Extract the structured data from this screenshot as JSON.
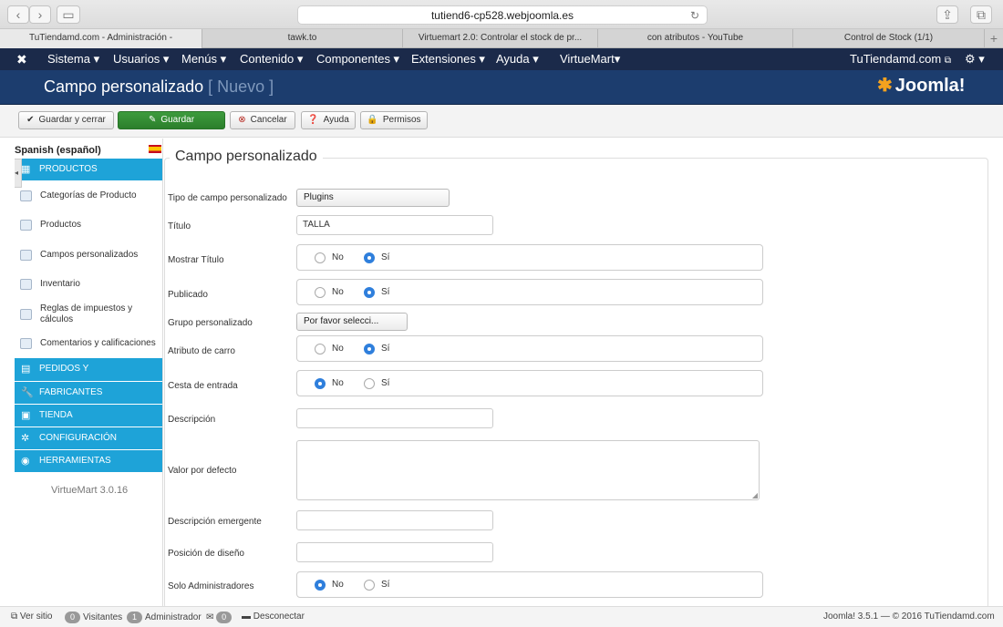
{
  "browser": {
    "url": "tutiend6-cp528.webjoomla.es",
    "tabs": [
      "TuTiendamd.com - Administración -",
      "tawk.to",
      "Virtuemart 2.0: Controlar el stock de pr...",
      "con atributos - YouTube",
      "Control de Stock (1/1)"
    ]
  },
  "nav": {
    "menu": [
      "Sistema ▾",
      "Usuarios ▾",
      "Menús ▾",
      "Contenido ▾",
      "Componentes ▾",
      "Extensiones ▾",
      "Ayuda ▾",
      "VirtueMart▾"
    ],
    "site_link": "TuTiendamd.com",
    "settings": "⚙ ▾"
  },
  "header": {
    "title": "Campo personalizado",
    "subtitle": "[ Nuevo ]",
    "brand": "Joomla!"
  },
  "toolbar": {
    "save_close": "Guardar y cerrar",
    "save": "Guardar",
    "cancel": "Cancelar",
    "help": "Ayuda",
    "permissions": "Permisos"
  },
  "sidebar": {
    "language": "Spanish (español)",
    "sections": [
      "PRODUCTOS",
      "PEDIDOS Y",
      "FABRICANTES",
      "TIENDA",
      "CONFIGURACIÓN",
      "HERRAMIENTAS"
    ],
    "items": [
      "Categorías de Producto",
      "Productos",
      "Campos personalizados",
      "Inventario",
      "Reglas de impuestos y cálculos",
      "Comentarios y calificaciones"
    ],
    "version": "VirtueMart 3.0.16"
  },
  "form": {
    "legend": "Campo personalizado",
    "yes": "Sí",
    "no": "No",
    "labels": {
      "type": "Tipo de campo personalizado",
      "title": "Título",
      "show_title": "Mostrar Título",
      "published": "Publicado",
      "group": "Grupo personalizado",
      "cart_attribute": "Atributo de carro",
      "input_cart": "Cesta de entrada",
      "description": "Descripción",
      "default_value": "Valor por defecto",
      "tooltip": "Descripción emergente",
      "layout_position": "Posición de diseño",
      "admin_only": "Solo Administradores"
    },
    "values": {
      "type": "Plugins",
      "title": "TALLA",
      "group": "Por favor selecci...",
      "show_title": "yes",
      "published": "yes",
      "cart_attribute": "yes",
      "input_cart": "no",
      "admin_only": "no"
    }
  },
  "status": {
    "view_site": "Ver sitio",
    "visitors_count": "0",
    "visitors": "Visitantes",
    "admins_count": "1",
    "admins": "Administrador",
    "messages_count": "0",
    "logout": "Desconectar",
    "version": "Joomla! 3.5.1",
    "copyright": "— © 2016 TuTiendamd.com"
  }
}
